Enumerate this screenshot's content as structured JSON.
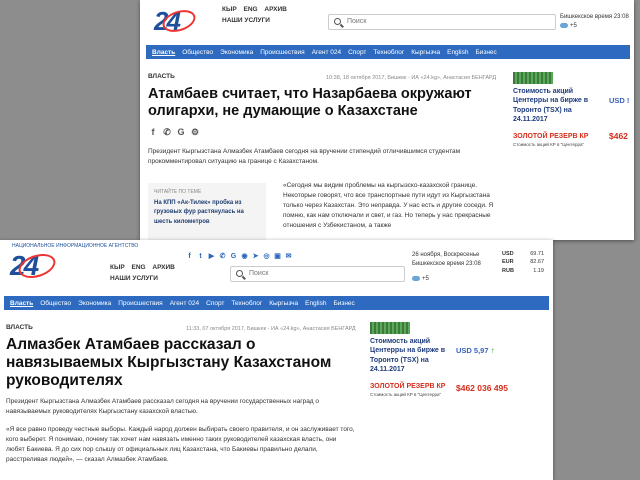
{
  "back": {
    "languages": [
      "КЫР",
      "ENG",
      "АРХИВ"
    ],
    "services": "НАШИ УСЛУГИ",
    "search_placeholder": "Поиск",
    "bishkek_time": "Бишкекское время 23:08",
    "weather": "+5",
    "nav": [
      "Власть",
      "Общество",
      "Экономика",
      "Происшествия",
      "Агент 024",
      "Спорт",
      "Техноблог",
      "Кыргызча",
      "English",
      "Бизнес"
    ],
    "rubric": "ВЛАСТЬ",
    "meta": "10:38, 18 октября 2017, Бишкек - ИА «24.kg», Анастасия БЕНГАРД",
    "title": "Атамбаев считает, что Назарбаева окружают олигархи, не думающие о Казахстане",
    "lead": "Президент Кыргызстана Алмазбек Атамбаев сегодня на вручении стипендий отличившимся студентам прокомментировал ситуацию на границе с Казахстаном.",
    "readmore_label": "ЧИТАЙТЕ ПО ТЕМЕ",
    "readmore_text": "На КПП «Ак-Тилек» пробка из грузовых фур растянулась на шесть километров",
    "quote": "«Сегодня мы видим проблемы на кыргызско-казахской границе. Некоторые говорят, что все транспортные пути идут из Кыргызстана только через Казахстан. Это неправда. У нас есть и другие соседи. Я помню, как нам отключали и свет, и газ. Но теперь у нас прекрасные отношения с Узбекистаном, а также",
    "ad": {
      "text": "Стоимость акций Центерры на бирже в Торонто (TSX) на 24.11.2017",
      "usd": "USD !",
      "gold": "ЗОЛОТОЙ РЕЗЕРВ КР",
      "gold_num": "$462",
      "gold_sub": "Стоимость акций КР в \"Центерра\""
    }
  },
  "front": {
    "logo_sub": "НАЦИОНАЛЬНОЕ ИНФОРМАЦИОННОЕ АГЕНТСТВО",
    "languages": [
      "КЫР",
      "ENG",
      "АРХИВ"
    ],
    "services": "НАШИ УСЛУГИ",
    "search_placeholder": "Поиск",
    "weather": "+5",
    "date": "26 ноября, Воскресенье",
    "bishkek_time": "Бишкекское время 23:08",
    "rates": [
      {
        "cur": "USD",
        "val": "69.71"
      },
      {
        "cur": "EUR",
        "val": "82.67"
      },
      {
        "cur": "RUB",
        "val": "1.19"
      }
    ],
    "nav": [
      "Власть",
      "Общество",
      "Экономика",
      "Происшествия",
      "Агент 024",
      "Спорт",
      "Техноблог",
      "Кыргызча",
      "English",
      "Бизнес"
    ],
    "rubric": "ВЛАСТЬ",
    "meta": "11:33, 07 октября 2017, Бишкек - ИА «24.kg», Анастасия БЕНГАРД",
    "title": "Алмазбек Атамбаев рассказал о навязываемых Кыргызстану Казахстаном руководителях",
    "lead": "Президент Кыргызстана Алмазбек Атамбаев рассказал сегодня на вручении государственных наград о навязываемых руководителях Кыргызстану казахской властью.",
    "quote": "«Я все равно проведу честные выборы. Каждый народ должен выбирать своего правителя, и он заслуживает того, кого выберет. Я понимаю, почему так хочет нам навязать именно таких руководителей казахская власть, они любят Бакиева. Я до сих пор слышу от официальных лиц Казахстана, что Бакиевы правильно делали, расстреливая людей», — сказал Алмазбек Атамбаев.",
    "ad": {
      "text": "Стоимость акций Центерры на бирже в Торонто (TSX) на 24.11.2017",
      "usd": "USD 5,97",
      "gold": "ЗОЛОТОЙ РЕЗЕРВ КР",
      "gold_num": "$462 036 495",
      "gold_sub": "Стоимость акций КР в \"Центерра\""
    }
  }
}
